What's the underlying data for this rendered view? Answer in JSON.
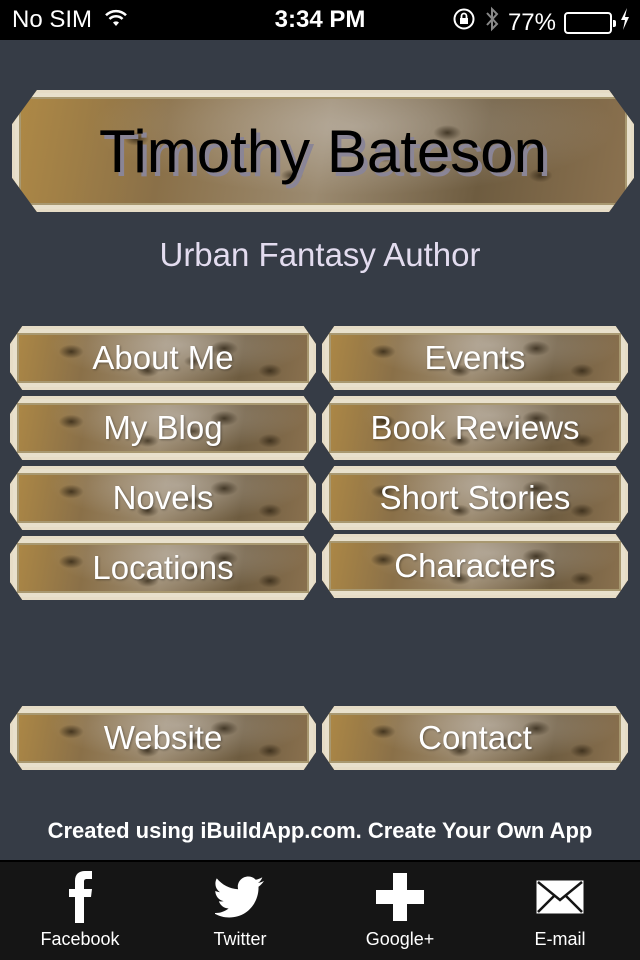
{
  "status_bar": {
    "carrier": "No SIM",
    "time": "3:34 PM",
    "battery_percent": "77%",
    "battery_level": 0.77,
    "battery_color": "#4cd964"
  },
  "header": {
    "title": "Timothy Bateson",
    "subtitle": "Urban Fantasy Author"
  },
  "menu": {
    "items": [
      {
        "label": "About Me"
      },
      {
        "label": "Events"
      },
      {
        "label": "My Blog"
      },
      {
        "label": "Book Reviews"
      },
      {
        "label": "Novels"
      },
      {
        "label": "Short Stories"
      },
      {
        "label": "Locations"
      },
      {
        "label": "Characters"
      }
    ],
    "links": [
      {
        "label": "Website"
      },
      {
        "label": "Contact"
      }
    ]
  },
  "footer": {
    "credit": "Created using iBuildApp.com. Create Your Own App"
  },
  "tabbar": {
    "tabs": [
      {
        "label": "Facebook",
        "icon": "facebook-icon"
      },
      {
        "label": "Twitter",
        "icon": "twitter-icon"
      },
      {
        "label": "Google+",
        "icon": "plus-icon"
      },
      {
        "label": "E-mail",
        "icon": "mail-icon"
      }
    ]
  },
  "colors": {
    "background": "#363c46",
    "subtitle": "#e3dcef",
    "tabbar": "#151515"
  }
}
